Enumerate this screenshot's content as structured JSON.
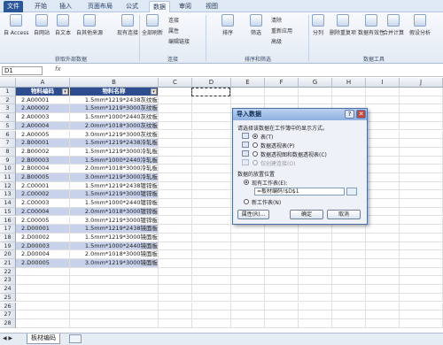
{
  "tabs": [
    "文件",
    "开始",
    "插入",
    "页面布局",
    "公式",
    "数据",
    "审阅",
    "视图"
  ],
  "active_tab": "数据",
  "ribbon": {
    "access": "自 Access",
    "web": "自网站",
    "text": "自文本",
    "other_sources": "自其他来源",
    "existing": "现有连接",
    "refresh_all": "全部刷新",
    "connections": "连接",
    "properties": "属性",
    "edit_links": "编辑链接",
    "sort": "排序",
    "filter": "筛选",
    "clear": "清除",
    "reapply": "重新应用",
    "advanced": "高级",
    "split": "分列",
    "remove_dup": "删除重复项",
    "validation": "数据有效性",
    "consolidate": "合并计算",
    "what_if": "假设分析",
    "groups": [
      "获取外部数据",
      "连接",
      "排序和筛选",
      "数据工具"
    ]
  },
  "formula_bar": {
    "name_box": "D1",
    "fx": "fx",
    "value": ""
  },
  "columns": [
    "A",
    "B",
    "C",
    "D",
    "E",
    "F",
    "G",
    "H",
    "I",
    "J"
  ],
  "header_row": {
    "a": "物料编码",
    "b": "物料名称"
  },
  "rows": [
    {
      "a": "2.A00001",
      "b": "1.5mm*1219*2438灰纹板"
    },
    {
      "a": "2.A00002",
      "b": "1.5mm*1219*3000灰纹板"
    },
    {
      "a": "2.A00003",
      "b": "1.5mm*1000*2440灰纹板"
    },
    {
      "a": "2.A00004",
      "b": "2.0mm*1018*3000灰纹板"
    },
    {
      "a": "2.A00005",
      "b": "3.0mm*1219*3000灰纹板"
    },
    {
      "a": "2.B00001",
      "b": "1.5mm*1219*2438冷轧板"
    },
    {
      "a": "2.B00002",
      "b": "1.5mm*1219*3000冷轧板"
    },
    {
      "a": "2.B00003",
      "b": "1.5mm*1000*2440冷轧板"
    },
    {
      "a": "2.B00004",
      "b": "2.0mm*1018*3000冷轧板"
    },
    {
      "a": "2.B00005",
      "b": "3.0mm*1219*3000冷轧板"
    },
    {
      "a": "2.C00001",
      "b": "1.5mm*1219*2438镀锌板"
    },
    {
      "a": "2.C00002",
      "b": "1.5mm*1219*3000镀锌板"
    },
    {
      "a": "2.C00003",
      "b": "1.5mm*1000*2440镀锌板"
    },
    {
      "a": "2.C00004",
      "b": "2.0mm*1018*3000镀锌板"
    },
    {
      "a": "2.C00005",
      "b": "3.0mm*1219*3000镀锌板"
    },
    {
      "a": "2.D00001",
      "b": "1.5mm*1219*2438镜面板"
    },
    {
      "a": "2.D00002",
      "b": "1.5mm*1219*3000镜面板"
    },
    {
      "a": "2.D00003",
      "b": "1.5mm*1000*2440镜面板"
    },
    {
      "a": "2.D00004",
      "b": "2.0mm*1018*3000镜面板"
    },
    {
      "a": "2.D00005",
      "b": "3.0mm*1219*3000镜面板"
    }
  ],
  "row_numbers": [
    "1",
    "2",
    "3",
    "4",
    "5",
    "6",
    "7",
    "8",
    "9",
    "10",
    "11",
    "12",
    "13",
    "14",
    "15",
    "16",
    "17",
    "18",
    "19",
    "20",
    "21",
    "22",
    "23",
    "24",
    "25",
    "26",
    "27",
    "28"
  ],
  "sheet_tab": "板材编码",
  "dialog": {
    "title": "导入数据",
    "help": "?",
    "close": "✕",
    "prompt": "请选择该数据在工作簿中的显示方式。",
    "opt_table": "表(T)",
    "opt_pivot": "数据透视表(P)",
    "opt_chart": "数据透视图和数据透视表(C)",
    "opt_conn": "仅创建连接(O)",
    "place_label": "数据的放置位置",
    "opt_existing": "现有工作表(E):",
    "range_value": "=板材编码!$D$1",
    "opt_new": "新工作表(N)",
    "props_btn": "属性(R)...",
    "ok_btn": "确定",
    "cancel_btn": "取消"
  },
  "colors": {
    "header_fill": "#2e4d8f",
    "band_fill": "#c8d2ea"
  }
}
